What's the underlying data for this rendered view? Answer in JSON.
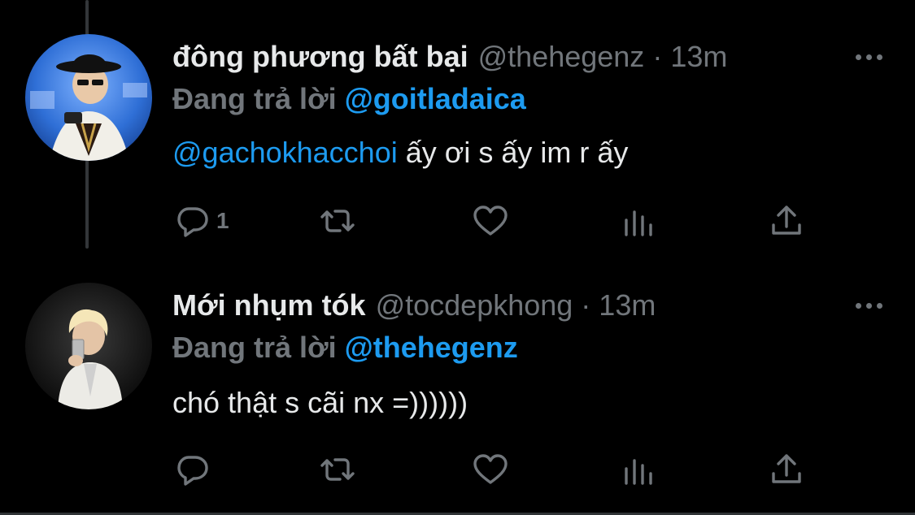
{
  "tweets": [
    {
      "name": "đông phương bất bại",
      "handle": "@thehegenz",
      "separator": "·",
      "time": "13m",
      "reply_label": "Đang trả lời",
      "reply_to": "@goitladaica",
      "body_mention": "@gachokhacchoi",
      "body_text": " ấy ơi s ấy im r ấy",
      "reply_count": "1",
      "avatar": "avatar-person-hat-sunglasses"
    },
    {
      "name": "Mới nhụm tók",
      "handle": "@tocdepkhong",
      "separator": "·",
      "time": "13m",
      "reply_label": "Đang trả lời",
      "reply_to": "@thehegenz",
      "body_mention": "",
      "body_text": "chó thật s cãi nx =))))))",
      "reply_count": "",
      "avatar": "avatar-blond-person-white-suit"
    }
  ],
  "icons": [
    "reply-icon",
    "retweet-icon",
    "like-icon",
    "views-icon",
    "share-icon",
    "more-icon"
  ],
  "colors": {
    "background": "#000000",
    "text": "#e7e9ea",
    "muted": "#71767b",
    "accent": "#1d9bf0"
  }
}
